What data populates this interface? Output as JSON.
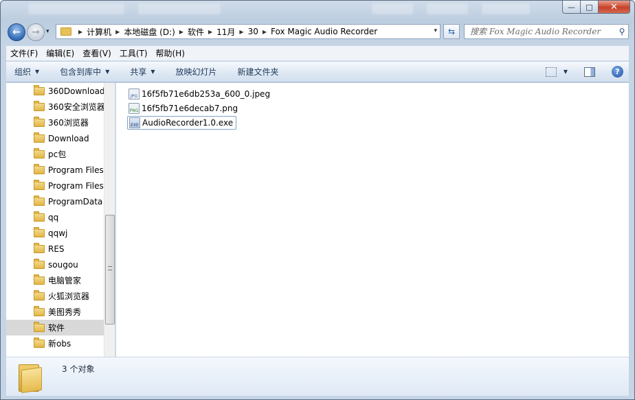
{
  "window": {
    "controls": {
      "minimize": "—",
      "maximize": "□",
      "close": "✕"
    }
  },
  "nav": {
    "back_glyph": "←",
    "forward_glyph": "→",
    "recent_glyph": "▾"
  },
  "address": {
    "crumbs": [
      "计算机",
      "本地磁盘 (D:)",
      "软件",
      "11月",
      "30",
      "Fox Magic Audio Recorder"
    ],
    "sep_glyph": "▶",
    "dropdown_glyph": "▾",
    "refresh_glyph": "⇆"
  },
  "search": {
    "placeholder": "搜索 Fox Magic Audio Recorder",
    "icon_glyph": "⚲"
  },
  "menu": [
    "文件(F)",
    "编辑(E)",
    "查看(V)",
    "工具(T)",
    "帮助(H)"
  ],
  "commands": {
    "organize": "组织",
    "include_library": "包含到库中",
    "share": "共享",
    "slideshow": "放映幻灯片",
    "new_folder": "新建文件夹",
    "dropdown_glyph": "▼",
    "help_glyph": "?"
  },
  "sidebar": {
    "items": [
      {
        "label": "360Download"
      },
      {
        "label": "360安全浏览器"
      },
      {
        "label": "360浏览器"
      },
      {
        "label": "Download"
      },
      {
        "label": "pc包"
      },
      {
        "label": "Program Files"
      },
      {
        "label": "Program Files"
      },
      {
        "label": "ProgramData"
      },
      {
        "label": "qq"
      },
      {
        "label": "qqwj"
      },
      {
        "label": "RES"
      },
      {
        "label": "sougou"
      },
      {
        "label": "电脑管家"
      },
      {
        "label": "火狐浏览器"
      },
      {
        "label": "美图秀秀"
      },
      {
        "label": "软件",
        "selected": true
      },
      {
        "label": "新obs"
      }
    ]
  },
  "files": [
    {
      "name": "16f5fb71e6db253a_600_0.jpeg",
      "type": "jpeg",
      "icon_label": "JPG"
    },
    {
      "name": "16f5fb71e6decab7.png",
      "type": "png",
      "icon_label": "PNG"
    },
    {
      "name": "AudioRecorder1.0.exe",
      "type": "exe",
      "icon_label": "EXE",
      "focused": true
    }
  ],
  "details": {
    "count_text": "3 个对象"
  },
  "colors": {
    "accent": "#1e395b",
    "selection": "#d9d9d9",
    "focus_border": "#7da2ce",
    "close_red": "#c8412a"
  }
}
